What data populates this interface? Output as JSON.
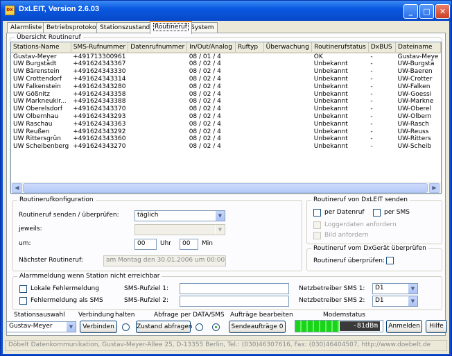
{
  "window": {
    "title": "DxLEIT, Version 2.6.03",
    "icon_text": "DX",
    "buttons": {
      "minimize": "_",
      "maximize": "□",
      "close": "✕"
    }
  },
  "tabs": [
    {
      "label": "Alarmliste",
      "active": false
    },
    {
      "label": "Betriebsprotokoll",
      "active": false
    },
    {
      "label": "Stationszustand",
      "active": false
    },
    {
      "label": "Routineruf",
      "active": true
    },
    {
      "label": "System",
      "active": false
    }
  ],
  "overview": {
    "legend": "Übersicht Routineruf",
    "columns": [
      "Stations-Name",
      "SMS-Rufnummer",
      "Datenrufnummer",
      "In/Out/Analog",
      "Ruftyp",
      "Überwachung",
      "Routinerufstatus",
      "DxBUS",
      "Dateiname"
    ],
    "rows": [
      [
        "Gustav-Meyer",
        "+491713300961",
        "",
        "08 / 01 / 4",
        "",
        "",
        "OK",
        "-",
        "Gustav-Meye"
      ],
      [
        "UW Burgstädt",
        "+491624343367",
        "",
        "08 / 02 / 4",
        "",
        "",
        "Unbekannt",
        "-",
        "UW-Burgstä"
      ],
      [
        "UW Bärenstein",
        "+491624343330",
        "",
        "08 / 02 / 4",
        "",
        "",
        "Unbekannt",
        "-",
        "UW-Baeren"
      ],
      [
        "UW Crottendorf",
        "+491624343314",
        "",
        "08 / 02 / 4",
        "",
        "",
        "Unbekannt",
        "-",
        "UW-Crotter"
      ],
      [
        "UW Falkenstein",
        "+491624343280",
        "",
        "08 / 02 / 4",
        "",
        "",
        "Unbekannt",
        "-",
        "UW-Falken"
      ],
      [
        "UW Gößnitz",
        "+491624343358",
        "",
        "08 / 02 / 4",
        "",
        "",
        "Unbekannt",
        "-",
        "UW-Goessi"
      ],
      [
        "UW Markneukir...",
        "+491624343388",
        "",
        "08 / 02 / 4",
        "",
        "",
        "Unbekannt",
        "-",
        "UW-Markne"
      ],
      [
        "UW Oberelsdorf",
        "+491624343370",
        "",
        "08 / 02 / 4",
        "",
        "",
        "Unbekannt",
        "-",
        "UW-Oberel"
      ],
      [
        "UW Olbernhau",
        "+491624343293",
        "",
        "08 / 02 / 4",
        "",
        "",
        "Unbekannt",
        "-",
        "UW-Olbern"
      ],
      [
        "UW Raschau",
        "+491624343363",
        "",
        "08 / 02 / 4",
        "",
        "",
        "Unbekannt",
        "-",
        "UW-Rasch"
      ],
      [
        "UW Reußen",
        "+491624343292",
        "",
        "08 / 02 / 4",
        "",
        "",
        "Unbekannt",
        "-",
        "UW-Reuss"
      ],
      [
        "UW Rittersgrün",
        "+491624343360",
        "",
        "08 / 02 / 4",
        "",
        "",
        "Unbekannt",
        "-",
        "UW-Ritters"
      ],
      [
        "UW Scheibenberg",
        "+491624343270",
        "",
        "08 / 02 / 4",
        "",
        "",
        "Unbekannt",
        "-",
        "UW-Scheib"
      ]
    ],
    "scroll_left": "◀",
    "scroll_right": "▶"
  },
  "config": {
    "legend": "Routinerufkonfiguration",
    "send_label": "Routineruf senden / überprüfen:",
    "send_value": "täglich",
    "each_label": "jeweils:",
    "each_value": "",
    "at_label": "um:",
    "hour_value": "00",
    "hour_unit": "Uhr",
    "min_value": "00",
    "min_unit": "Min",
    "next_label": "Nächster Routineruf:",
    "next_value": "am Montag den 30.01.2006 um 00:00 Uhr"
  },
  "send_group": {
    "legend": "Routineruf von DxLEIT senden",
    "per_datenruf": "per Datenruf",
    "per_sms": "per SMS",
    "logger": "Loggerdaten anfordern",
    "bild": "Bild anfordern"
  },
  "check_group": {
    "legend": "Routineruf vom DxGerät überprüfen",
    "label": "Routineruf überprüfen:"
  },
  "alarm": {
    "legend": "Alarmmeldung wenn Station nicht erreichbar",
    "local_label": "Lokale Fehlermeldung",
    "sms_label": "Fehlermeldung als SMS",
    "sms1_label": "SMS-Rufziel 1:",
    "sms1_value": "",
    "sms2_label": "SMS-Rufziel 2:",
    "sms2_value": "",
    "net1_label": "Netzbetreiber SMS 1:",
    "net1_value": "D1",
    "net2_label": "Netzbetreiber SMS 2:",
    "net2_value": "D1"
  },
  "bottom": {
    "station_label": "Stationsauswahl",
    "station_value": "Gustav-Meyer",
    "conn_label": "Verbindung",
    "hold_label": "halten",
    "connect_button": "Verbinden",
    "query_label": "Abfrage per DATA/SMS",
    "query_button": "Zustand abfragen",
    "jobs_label": "Aufträge bearbeiten",
    "jobs_button": "Sendeaufträge 0",
    "modem_label": "Modemstatus",
    "modem_value": "-81dBm",
    "modem_level_fraction": 0.5,
    "login_button": "Anmelden",
    "help_button": "Hilfe"
  },
  "statusbar": "Döbelt Datenkommunikation, Gustav-Meyer-Allee 25, D-13355 Berlin, Tel.: (030)46307616, Fax: (030)46404507, http://www.doebelt.de"
}
